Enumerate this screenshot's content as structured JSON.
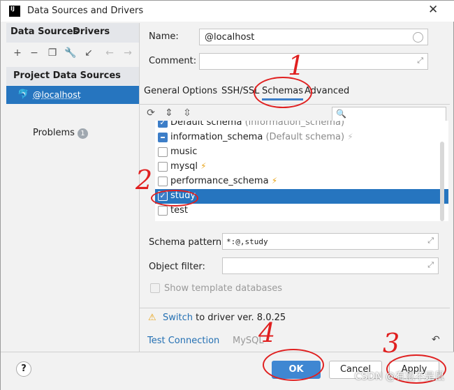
{
  "window": {
    "title": "Data Sources and Drivers",
    "app_icon": "IJ",
    "close_glyph": "✕"
  },
  "left": {
    "tabs": [
      "Data Sources",
      "Drivers"
    ],
    "section": "Project Data Sources",
    "selected_item": "@localhost",
    "problems_label": "Problems",
    "problems_count": "1"
  },
  "form": {
    "name_label": "Name:",
    "name_value": "@localhost",
    "comment_label": "Comment:",
    "comment_value": ""
  },
  "tabs": [
    "General",
    "Options",
    "SSH/SSL",
    "Schemas",
    "Advanced"
  ],
  "schemas": [
    {
      "name": "Default schema",
      "note": "(information_schema)",
      "state": "checked"
    },
    {
      "name": "information_schema",
      "note": "(Default schema)",
      "state": "indeterminate",
      "bolt": "dim"
    },
    {
      "name": "music",
      "note": "",
      "state": "unchecked"
    },
    {
      "name": "mysql",
      "note": "",
      "state": "unchecked",
      "bolt": "on"
    },
    {
      "name": "performance_schema",
      "note": "",
      "state": "unchecked",
      "bolt": "on"
    },
    {
      "name": "study",
      "note": "",
      "state": "checked",
      "highlight": true
    },
    {
      "name": "test",
      "note": "",
      "state": "unchecked"
    }
  ],
  "pattern": {
    "label": "Schema pattern:",
    "value": "*:@,study"
  },
  "filter": {
    "label": "Object filter:",
    "value": ""
  },
  "template_label": "Show template databases",
  "warning": {
    "link": "Switch",
    "text": "to driver ver. 8.0.25"
  },
  "test_connection": "Test Connection",
  "driver_name": "MySQL",
  "buttons": {
    "ok": "OK",
    "cancel": "Cancel",
    "apply": "Apply",
    "help": "?"
  },
  "annotations": [
    "1",
    "2",
    "3",
    "4"
  ],
  "watermark": "CSDN @有鼠不是鼠"
}
